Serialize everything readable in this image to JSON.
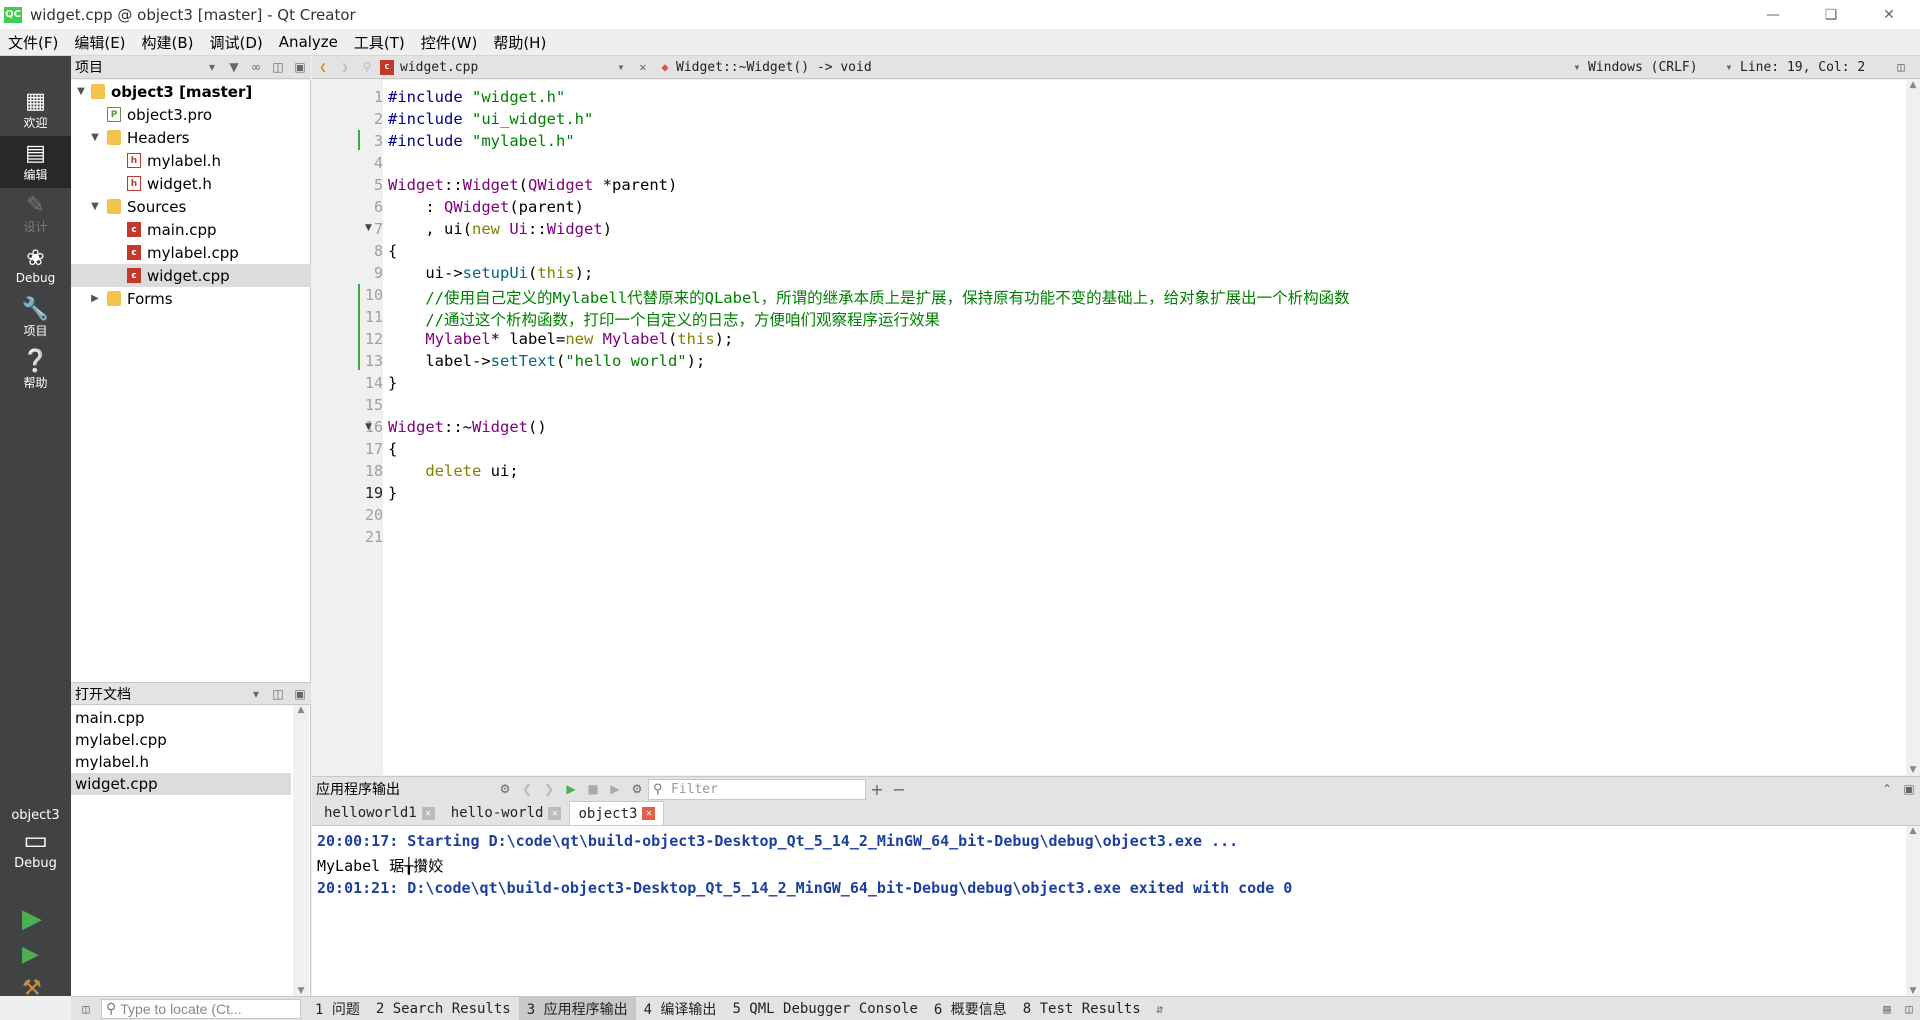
{
  "window": {
    "title": "widget.cpp @ object3 [master] - Qt Creator",
    "logo": "QC"
  },
  "menu": [
    "文件(F)",
    "编辑(E)",
    "构建(B)",
    "调试(D)",
    "Analyze",
    "工具(T)",
    "控件(W)",
    "帮助(H)"
  ],
  "modes": [
    {
      "label": "欢迎",
      "icon": "grid-icon"
    },
    {
      "label": "编辑",
      "icon": "document-icon"
    },
    {
      "label": "设计",
      "icon": "pen-icon"
    },
    {
      "label": "Debug",
      "icon": "bug-icon"
    },
    {
      "label": "项目",
      "icon": "wrench-icon"
    },
    {
      "label": "帮助",
      "icon": "help-icon"
    }
  ],
  "kit": {
    "project": "object3",
    "config": "Debug"
  },
  "project_panel": {
    "header": "项目",
    "tree": [
      {
        "label": "object3 [master]",
        "type": "project",
        "depth": 0,
        "expanded": true
      },
      {
        "label": "object3.pro",
        "type": "pro",
        "depth": 1
      },
      {
        "label": "Headers",
        "type": "folder",
        "depth": 1,
        "expanded": true
      },
      {
        "label": "mylabel.h",
        "type": "h",
        "depth": 2
      },
      {
        "label": "widget.h",
        "type": "h",
        "depth": 2
      },
      {
        "label": "Sources",
        "type": "folder",
        "depth": 1,
        "expanded": true
      },
      {
        "label": "main.cpp",
        "type": "cpp",
        "depth": 2
      },
      {
        "label": "mylabel.cpp",
        "type": "cpp",
        "depth": 2
      },
      {
        "label": "widget.cpp",
        "type": "cpp",
        "depth": 2,
        "selected": true
      },
      {
        "label": "Forms",
        "type": "folder",
        "depth": 1,
        "expanded": false
      }
    ]
  },
  "open_docs": {
    "header": "打开文档",
    "items": [
      "main.cpp",
      "mylabel.cpp",
      "mylabel.h",
      "widget.cpp"
    ],
    "selected": "widget.cpp"
  },
  "editor_toolbar": {
    "file": "widget.cpp",
    "symbol": "Widget::~Widget() -> void",
    "line_ending": "Windows (CRLF)",
    "position": "Line: 19, Col: 2"
  },
  "editor": {
    "current_line": 19,
    "line_numbers": [
      "1",
      "2",
      "3",
      "4",
      "5",
      "6",
      "7",
      "8",
      "9",
      "10",
      "11",
      "12",
      "13",
      "14",
      "15",
      "16",
      "17",
      "18",
      "19",
      "20",
      "21"
    ],
    "lines": [
      "#include \"widget.h\"",
      "#include \"ui_widget.h\"",
      "#include \"mylabel.h\"",
      "",
      "Widget::Widget(QWidget *parent)",
      "    : QWidget(parent)",
      "    , ui(new Ui::Widget)",
      "{",
      "    ui->setupUi(this);",
      "    //使用自己定义的Mylabell代替原来的QLabel，所谓的继承本质上是扩展，保持原有功能不变的基础上，给对象扩展出一个析构函数",
      "    //通过这个析构函数，打印一个自定义的日志，方便咱们观察程序运行效果",
      "    Mylabel* label=new Mylabel(this);",
      "    label->setText(\"hello world\");",
      "}",
      "",
      "Widget::~Widget()",
      "{",
      "    delete ui;",
      "}",
      "",
      ""
    ]
  },
  "output": {
    "title": "应用程序输出",
    "filter_placeholder": "Filter",
    "tabs": [
      "helloworld1",
      "hello-world",
      "object3"
    ],
    "active_tab": "object3",
    "lines": [
      "20:00:17: Starting D:\\code\\qt\\build-object3-Desktop_Qt_5_14_2_MinGW_64_bit-Debug\\debug\\object3.exe ...",
      "MyLabel 琚╁攢姣",
      "20:01:21: D:\\code\\qt\\build-object3-Desktop_Qt_5_14_2_MinGW_64_bit-Debug\\debug\\object3.exe exited with code 0"
    ]
  },
  "statusbar": {
    "locator_placeholder": "Type to locate (Ct...",
    "panes": [
      "1 问题",
      "2 Search Results",
      "3 应用程序输出",
      "4 编译输出",
      "5 QML Debugger Console",
      "6 概要信息",
      "8 Test Results"
    ],
    "active_pane": "3 应用程序输出"
  },
  "colors": {
    "mode_bar": "#404244",
    "preprocessor": "#000080",
    "string": "#008000",
    "type": "#800080",
    "comment": "#008000",
    "keyword": "#808000",
    "output_info": "#1d3fa0"
  }
}
